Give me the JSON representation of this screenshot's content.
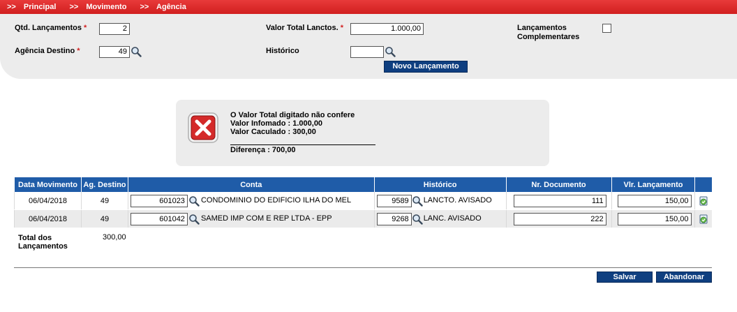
{
  "breadcrumb": [
    "Principal",
    "Movimento",
    "Agência"
  ],
  "breadcrumb_prefix": ">>",
  "form": {
    "qtd_label": "Qtd. Lançamentos",
    "qtd_value": "2",
    "agencia_label": "Agência Destino",
    "agencia_value": "49",
    "valor_total_label": "Valor Total Lanctos.",
    "valor_total_value": "1.000,00",
    "historico_label": "Histórico",
    "historico_value": "",
    "complementares_label_1": "Lançamentos",
    "complementares_label_2": "Complementares",
    "complementares_checked": false,
    "required_mark": "*",
    "novo_button": "Novo Lançamento"
  },
  "error": {
    "line1": "O Valor Total digitado não confere",
    "line2": "Valor Infomado : 1.000,00",
    "line3": "Valor Caculado : 300,00",
    "diff": "Diferença : 700,00"
  },
  "table": {
    "headers": [
      "Data Movimento",
      "Ag. Destino",
      "Conta",
      "Histórico",
      "Nr. Documento",
      "Vlr. Lançamento"
    ],
    "rows": [
      {
        "data": "06/04/2018",
        "agencia": "49",
        "conta_num": "601023",
        "conta_nome": "CONDOMINIO DO EDIFICIO ILHA DO MEL",
        "hist_num": "9589",
        "hist_nome": "LANCTO. AVISADO",
        "documento": "111",
        "valor": "150,00"
      },
      {
        "data": "06/04/2018",
        "agencia": "49",
        "conta_num": "601042",
        "conta_nome": "SAMED IMP COM E REP LTDA - EPP",
        "hist_num": "9268",
        "hist_nome": "LANC. AVISADO",
        "documento": "222",
        "valor": "150,00"
      }
    ]
  },
  "totals": {
    "label_1": "Total dos",
    "label_2": "Lançamentos",
    "value": "300,00"
  },
  "actions": {
    "save": "Salvar",
    "abandon": "Abandonar"
  },
  "colors": {
    "header_red": "#d11f1f",
    "button_blue": "#0f3f80",
    "table_header_blue": "#1f5ca8"
  }
}
